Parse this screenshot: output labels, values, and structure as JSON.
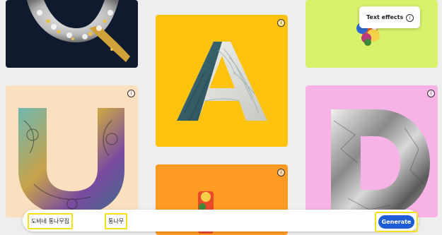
{
  "gallery": {
    "tiles": [
      {
        "letter": "Q",
        "style": "pearl-gold",
        "background": "#0f1a2e"
      },
      {
        "letter": "A",
        "style": "quilted-fabric",
        "background": "#ffc20e"
      },
      {
        "letter": "",
        "style": "floral",
        "background": "#d8f26b"
      },
      {
        "letter": "U",
        "style": "ornate-metal",
        "background": "#fbe0bf"
      },
      {
        "letter": "",
        "style": "fruit-tower",
        "background": "#ff9a22"
      },
      {
        "letter": "D",
        "style": "crumpled-foil",
        "background": "#f7b2e6"
      }
    ],
    "info_glyph": "i"
  },
  "popup": {
    "title": "Text effects",
    "info_glyph": "i"
  },
  "prompt_bar": {
    "chip_1": "도비네 통나무집",
    "chip_2": "통나무",
    "generate_label": "Generate"
  },
  "colors": {
    "accent": "#1f5dd6",
    "highlight": "#f5e11a"
  }
}
